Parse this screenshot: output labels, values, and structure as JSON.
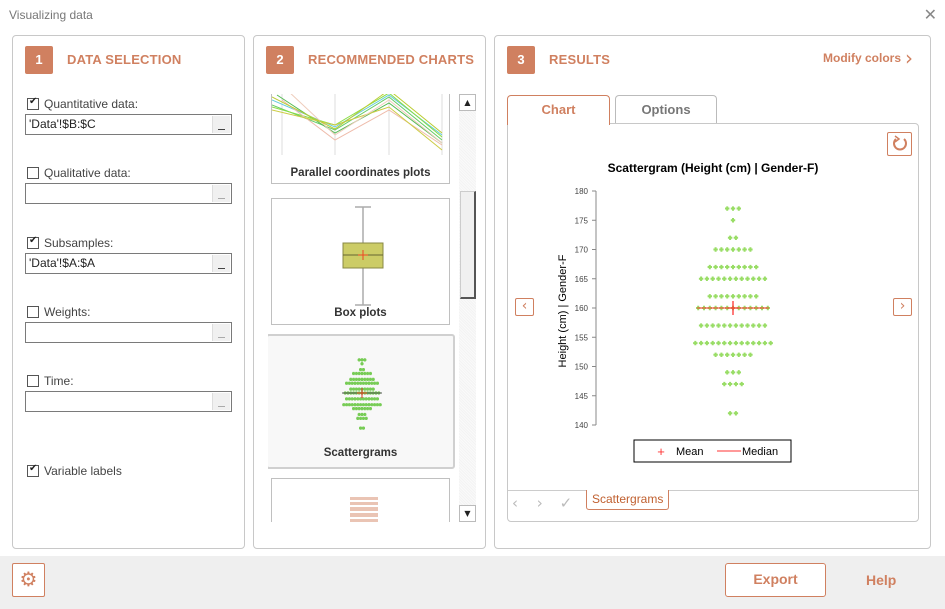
{
  "window": {
    "title": "Visualizing data",
    "close_icon": "close-icon"
  },
  "data_selection": {
    "step": "1",
    "title": "DATA SELECTION",
    "fields": [
      {
        "label": "Quantitative data:",
        "checked": true,
        "value": "'Data'!$B:$C"
      },
      {
        "label": "Qualitative data:",
        "checked": false,
        "value": ""
      },
      {
        "label": "Subsamples:",
        "checked": true,
        "value": "'Data'!$A:$A"
      },
      {
        "label": "Weights:",
        "checked": false,
        "value": ""
      },
      {
        "label": "Time:",
        "checked": false,
        "value": ""
      }
    ],
    "variable_labels": {
      "label": "Variable labels",
      "checked": true
    }
  },
  "recommended_charts": {
    "step": "2",
    "title": "RECOMMENDED CHARTS",
    "items": [
      {
        "label": "Parallel coordinates plots",
        "selected": false
      },
      {
        "label": "Box plots",
        "selected": false
      },
      {
        "label": "Scattergrams",
        "selected": true
      },
      {
        "label": "",
        "selected": false
      }
    ]
  },
  "results": {
    "step": "3",
    "title": "RESULTS",
    "modify_colors": "Modify colors",
    "tabs": [
      {
        "label": "Chart",
        "active": true
      },
      {
        "label": "Options",
        "active": false
      }
    ],
    "sheet_tab": "Scattergrams"
  },
  "footer": {
    "export_label": "Export",
    "help_label": "Help"
  },
  "colors": {
    "accent": "#d08060",
    "point": "#99dd66",
    "mean": "#ff3333"
  },
  "chart_data": {
    "type": "scatter",
    "title": "Scattergram (Height (cm) | Gender-F)",
    "ylabel": "Height (cm) | Gender-F",
    "xlabel": "",
    "ylim": [
      140,
      180
    ],
    "yticks": [
      "140",
      "145",
      "150",
      "155",
      "160",
      "165",
      "170",
      "175",
      "180"
    ],
    "grid": false,
    "rows": [
      {
        "y": 177,
        "count": 3
      },
      {
        "y": 175,
        "count": 1
      },
      {
        "y": 172,
        "count": 2
      },
      {
        "y": 170,
        "count": 7
      },
      {
        "y": 167,
        "count": 9
      },
      {
        "y": 165,
        "count": 12
      },
      {
        "y": 162,
        "count": 9
      },
      {
        "y": 160,
        "count": 13
      },
      {
        "y": 157,
        "count": 12
      },
      {
        "y": 154,
        "count": 14
      },
      {
        "y": 152,
        "count": 7
      },
      {
        "y": 149,
        "count": 3
      },
      {
        "y": 147,
        "count": 4
      },
      {
        "y": 142,
        "count": 2
      }
    ],
    "mean": 160,
    "median": 160,
    "legend": [
      {
        "symbol": "+",
        "label": "Mean"
      },
      {
        "symbol": "line",
        "label": "Median"
      }
    ],
    "legend_position": "bottom"
  }
}
